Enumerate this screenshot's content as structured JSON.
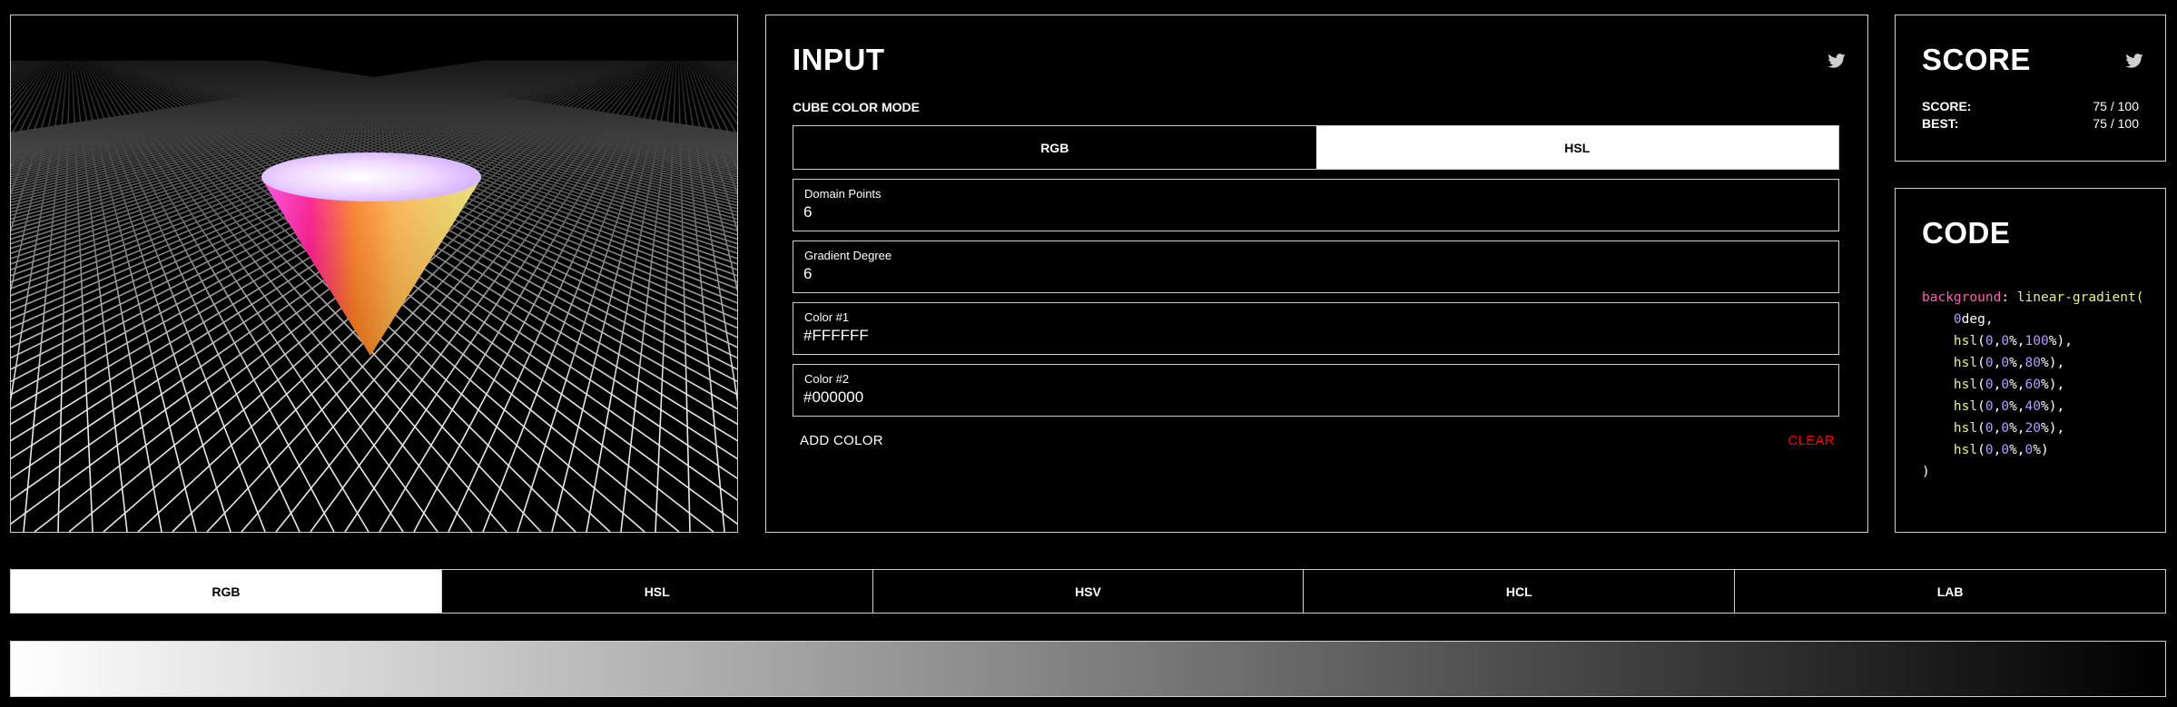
{
  "input": {
    "title": "INPUT",
    "cube_color_mode_label": "CUBE COLOR MODE",
    "modes": [
      {
        "label": "RGB",
        "active": false
      },
      {
        "label": "HSL",
        "active": true
      }
    ],
    "fields": [
      {
        "label": "Domain Points",
        "value": "6"
      },
      {
        "label": "Gradient Degree",
        "value": "6"
      },
      {
        "label": "Color #1",
        "value": "#FFFFFF"
      },
      {
        "label": "Color #2",
        "value": "#000000"
      }
    ],
    "add_color": "ADD COLOR",
    "clear": "CLEAR"
  },
  "score": {
    "title": "SCORE",
    "score_label": "SCORE:",
    "score_value": "75 / 100",
    "best_label": "BEST:",
    "best_value": "75 / 100"
  },
  "code": {
    "title": "CODE",
    "property": "background",
    "function": "linear-gradient(",
    "angle_value": "0",
    "angle_unit": "deg,",
    "stops": [
      {
        "h": "0",
        "s": "0",
        "l": "100",
        "sep": ","
      },
      {
        "h": "0",
        "s": "0",
        "l": "80",
        "sep": ","
      },
      {
        "h": "0",
        "s": "0",
        "l": "60",
        "sep": ","
      },
      {
        "h": "0",
        "s": "0",
        "l": "40",
        "sep": ","
      },
      {
        "h": "0",
        "s": "0",
        "l": "20",
        "sep": ","
      },
      {
        "h": "0",
        "s": "0",
        "l": "0",
        "sep": ""
      }
    ],
    "close": ")"
  },
  "space_tabs": [
    {
      "label": "RGB",
      "active": true
    },
    {
      "label": "HSL",
      "active": false
    },
    {
      "label": "HSV",
      "active": false
    },
    {
      "label": "HCL",
      "active": false
    },
    {
      "label": "LAB",
      "active": false
    }
  ],
  "colors": {
    "background": "#000000",
    "border": "#cfcfcf",
    "clear_red": "#ff0000",
    "code_property": "#ff5fb3",
    "code_function": "#e9f280",
    "code_number": "#b79bff"
  },
  "icons": {
    "social": "twitter-icon"
  }
}
